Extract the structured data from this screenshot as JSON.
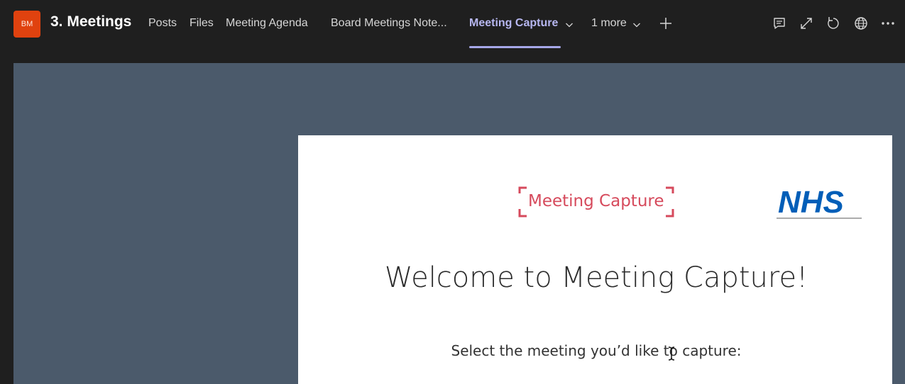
{
  "header": {
    "team_initials": "BM",
    "team_name": "3. Meetings",
    "tabs": [
      {
        "label": "Posts"
      },
      {
        "label": "Files"
      },
      {
        "label": "Meeting Agenda"
      },
      {
        "label": "Board Meetings Note..."
      },
      {
        "label": "Meeting Capture"
      },
      {
        "label": "1 more"
      }
    ],
    "active_tab": "Meeting Capture",
    "icons": [
      "add-tab-icon",
      "conversation-icon",
      "expand-icon",
      "refresh-icon",
      "globe-icon",
      "more-options-icon"
    ]
  },
  "app": {
    "logo_text": "Meeting Capture",
    "nhs_logo_text": "NHS",
    "welcome": "Welcome to Meeting Capture!",
    "prompt": "Select the meeting you’d like to capture:"
  },
  "colors": {
    "accent_tab": "#a6a7e8",
    "team_avatar": "#e0420f",
    "logo_red": "#d64a5c",
    "nhs_blue": "#005eb8",
    "content_bg": "#4b5a6b"
  }
}
